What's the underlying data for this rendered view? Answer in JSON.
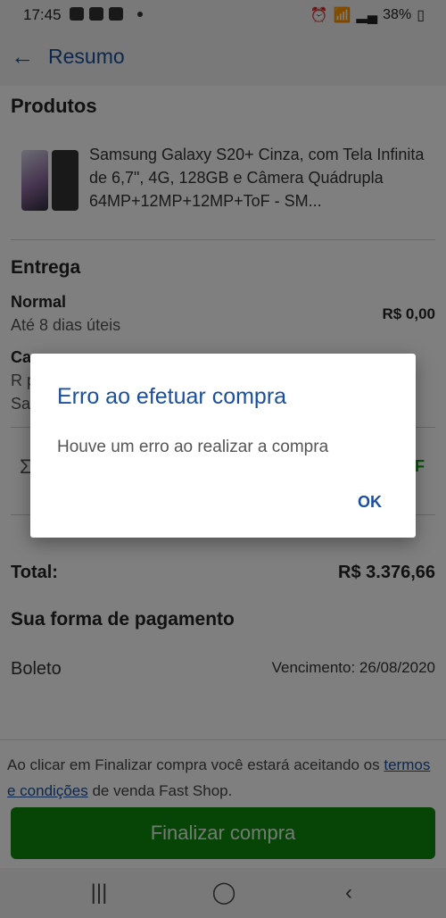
{
  "status_bar": {
    "time": "17:45",
    "battery": "38%",
    "icons": [
      "b-notification-icon",
      "photos-notification-icon",
      "mail-icon",
      "dot-icon",
      "alarm-icon",
      "wifi-icon",
      "signal-icon",
      "battery-icon"
    ]
  },
  "app_bar": {
    "back_icon": "arrow-left-icon",
    "title": "Resumo"
  },
  "products": {
    "section_title": "Produtos",
    "item_name": "Samsung Galaxy S20+ Cinza, com Tela Infinita de 6,7\", 4G, 128GB e Câmera Quádrupla 64MP+12MP+12MP+ToF - SM..."
  },
  "delivery": {
    "section_title": "Entrega",
    "normal_label": "Normal",
    "normal_eta": "Até 8 dias úteis",
    "normal_price": "R$ 0,00",
    "partial_label": "Ca",
    "partial_line1": "R p",
    "partial_line2": "Sa",
    "partial_icon": "sigma-icon",
    "partial_right": "F"
  },
  "total": {
    "label": "Total:",
    "value": "R$ 3.376,66"
  },
  "payment": {
    "section_title": "Sua forma de pagamento",
    "method": "Boleto",
    "due": "Vencimento: 26/08/2020"
  },
  "footer": {
    "terms_prefix": "Ao clicar em Finalizar compra você estará aceitando os",
    "terms_link": "termos e condições",
    "terms_suffix": "de venda Fast Shop.",
    "finalize_label": "Finalizar compra"
  },
  "nav_bar": {
    "recent_icon": "recent-apps-icon",
    "home_icon": "home-icon",
    "back_icon": "back-chevron-icon"
  },
  "dialog": {
    "title": "Erro ao efetuar compra",
    "message": "Houve um erro ao realizar a compra",
    "ok_label": "OK"
  },
  "colors": {
    "accent": "#1b4f9c",
    "finalize": "#0f8a0f",
    "scrim": "rgba(0,0,0,0.5)"
  }
}
